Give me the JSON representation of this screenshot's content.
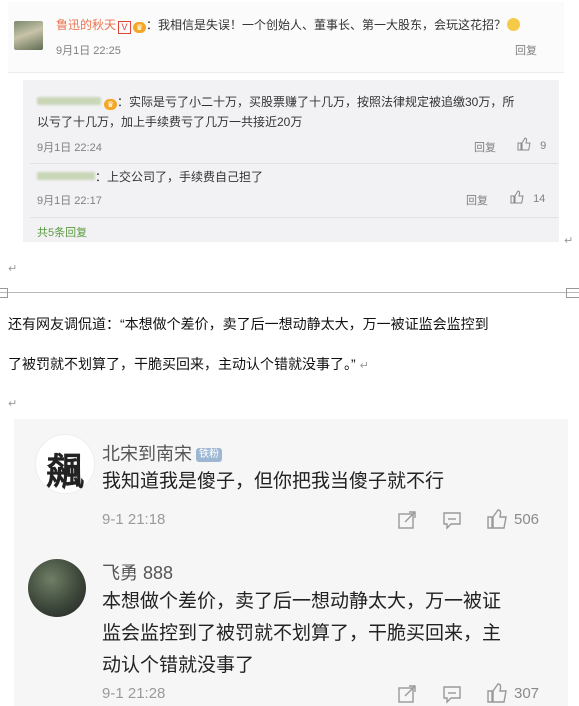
{
  "top": {
    "comment": {
      "username": "鲁迅的秋天",
      "v_mark": "V",
      "text": "：我相信是失误！一个创始人、董事长、第一大股东，会玩这花招？",
      "time": "9月1日 22:25",
      "reply": "回复"
    },
    "replies": [
      {
        "text_line1": "：实际是亏了小二十万，买股票赚了十几万，按照法律规定被追缴30万，所",
        "text_line2": "以亏了十几万，加上手续费亏了几万一共接近20万",
        "time": "9月1日 22:24",
        "reply": "回复",
        "likes": "9"
      },
      {
        "text_line1": "：上交公司了，手续费自己担了",
        "time": "9月1日 22:17",
        "reply": "回复",
        "likes": "14"
      }
    ],
    "more": "共5条回复",
    "return_mark": "↵"
  },
  "doc": {
    "line1": "还有网友调侃道：“本想做个差价，卖了后一想动静太大，万一被证监会监控到",
    "line2": "了被罚就不划算了，干脆买回来，主动认个错就没事了。”",
    "return_mark": "↵"
  },
  "bottom": {
    "comments": [
      {
        "avatar_text": "飆",
        "name": "北宋到南宋",
        "badge": "铁粉",
        "lines": [
          "我知道我是傻子，但你把我当傻子就不行"
        ],
        "time": "9-1 21:18",
        "likes": "506"
      },
      {
        "name": "飞勇 888",
        "lines": [
          "本想做个差价，卖了后一想动静太大，万一被证",
          "监会监控到了被罚就不划算了，干脆买回来，主",
          "动认个错就没事了"
        ],
        "time": "9-1 21:28",
        "likes": "307"
      }
    ]
  },
  "colors": {
    "username": "#eb7350",
    "more_link": "#5b9a3f",
    "verified": "#e0453a"
  },
  "icons": [
    "vip-icon",
    "emoji-icon",
    "thumb-up-icon",
    "share-icon",
    "comment-icon"
  ]
}
